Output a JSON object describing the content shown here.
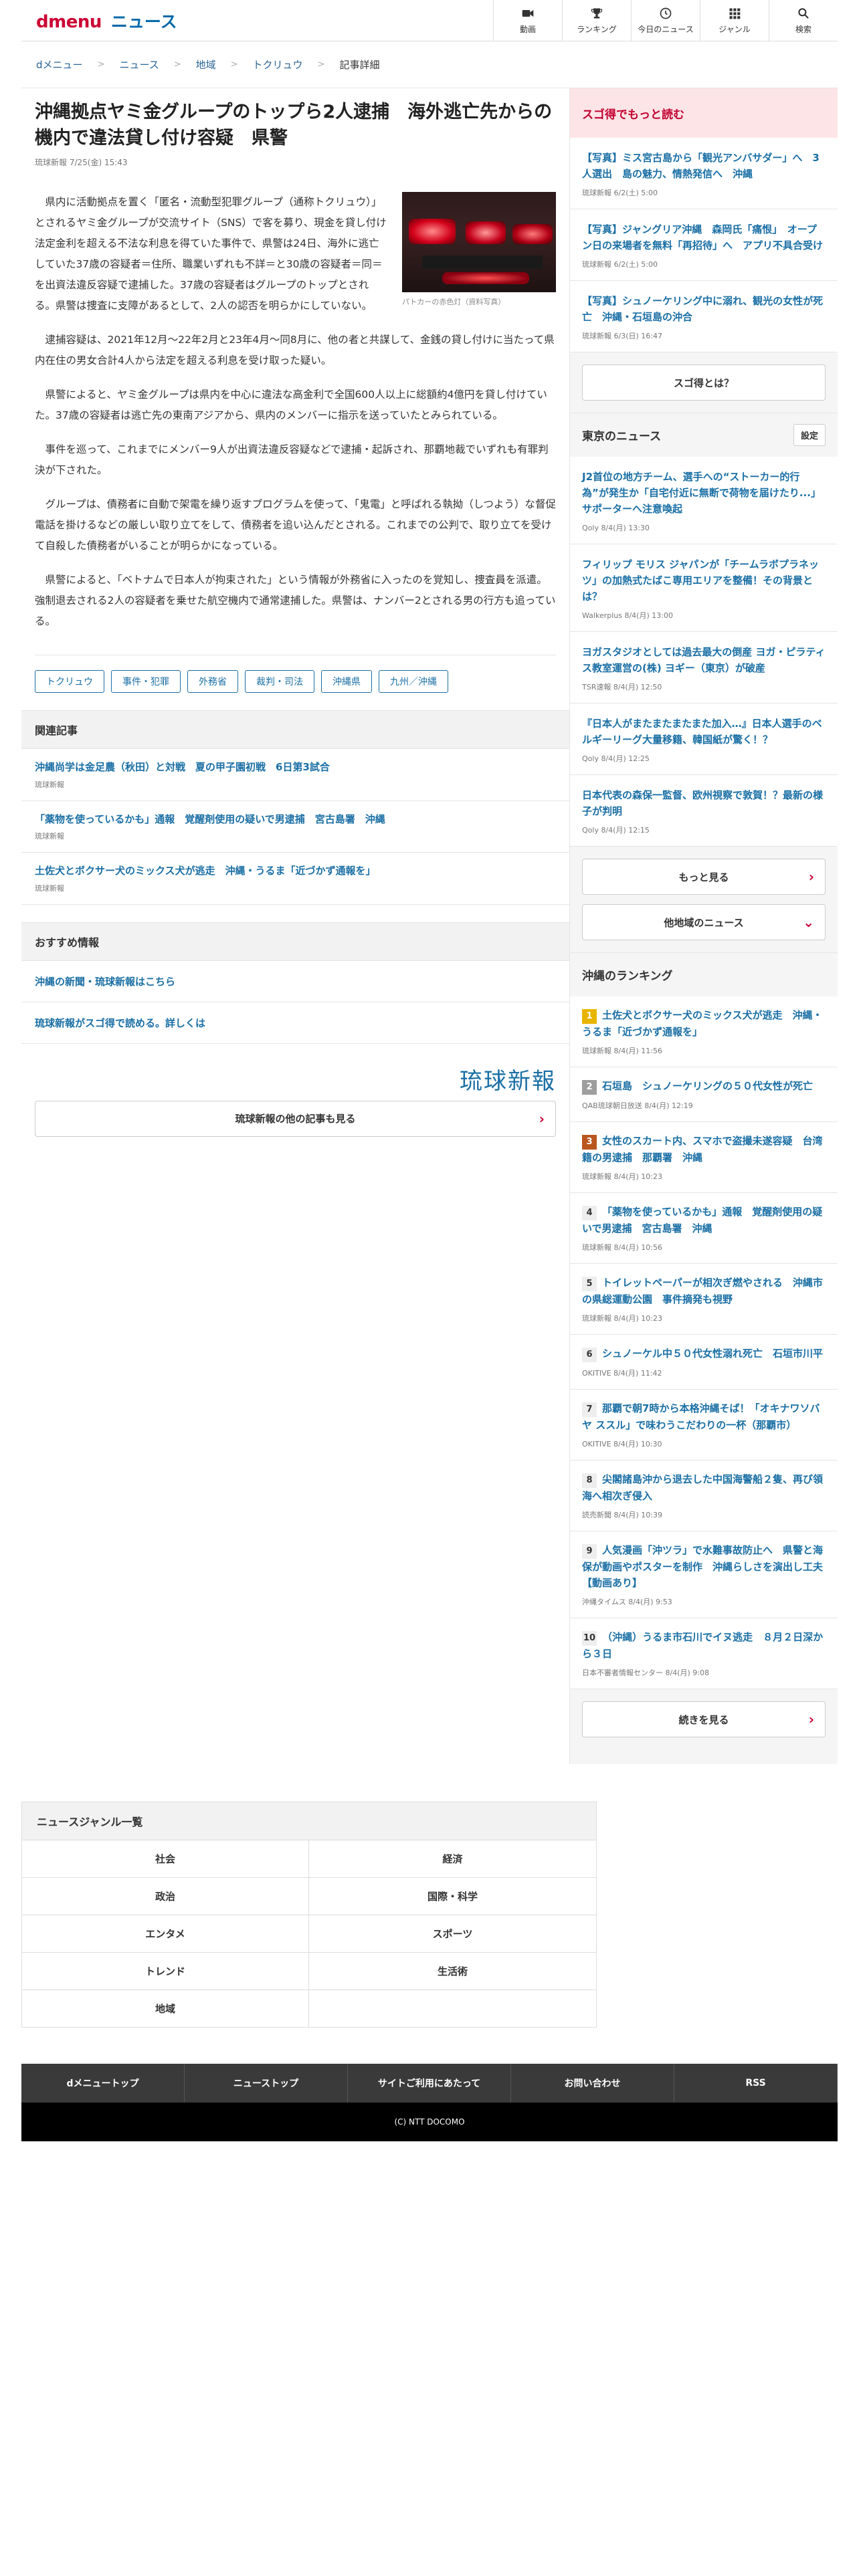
{
  "header": {
    "logo_d": "d",
    "logo_menu": "menu",
    "logo_news": "ニュース",
    "nav": [
      {
        "label": "動画",
        "icon": "video-icon"
      },
      {
        "label": "ランキング",
        "icon": "trophy-icon"
      },
      {
        "label": "今日のニュース",
        "icon": "clock-icon"
      },
      {
        "label": "ジャンル",
        "icon": "grid-icon"
      },
      {
        "label": "検索",
        "icon": "search-icon"
      }
    ]
  },
  "breadcrumb": [
    "dメニュー",
    "ニュース",
    "地域",
    "トクリュウ",
    "記事詳細"
  ],
  "article": {
    "title": "沖縄拠点ヤミ金グループのトップら2人逮捕　海外逃亡先からの機内で違法貸し付け容疑　県警",
    "meta": "琉球新報 7/25(金) 15:43",
    "photo_caption": "パトカーの赤色灯（資料写真）",
    "paragraphs": [
      "県内に活動拠点を置く「匿名・流動型犯罪グループ（通称トクリュウ）」とされるヤミ金グループが交流サイト（SNS）で客を募り、現金を貸し付け法定金利を超える不法な利息を得ていた事件で、県警は24日、海外に逃亡していた37歳の容疑者＝住所、職業いずれも不詳＝と30歳の容疑者＝同＝を出資法違反容疑で逮捕した。37歳の容疑者はグループのトップとされる。県警は捜査に支障があるとして、2人の認否を明らかにしていない。",
      "逮捕容疑は、2021年12月〜22年2月と23年4月〜同8月に、他の者と共謀して、金銭の貸し付けに当たって県内在住の男女合計4人から法定を超える利息を受け取った疑い。",
      "県警によると、ヤミ金グループは県内を中心に違法な高金利で全国600人以上に総額約4億円を貸し付けていた。37歳の容疑者は逃亡先の東南アジアから、県内のメンバーに指示を送っていたとみられている。",
      "事件を巡って、これまでにメンバー9人が出資法違反容疑などで逮捕・起訴され、那覇地裁でいずれも有罪判決が下された。",
      "グループは、債務者に自動で架電を繰り返すプログラムを使って、「鬼電」と呼ばれる執拗（しつよう）な督促電話を掛けるなどの厳しい取り立てをして、債務者を追い込んだとされる。これまでの公判で、取り立てを受けて自殺した債務者がいることが明らかになっている。",
      "県警によると、「ベトナムで日本人が拘束された」という情報が外務省に入ったのを覚知し、捜査員を派遣。強制退去される2人の容疑者を乗せた航空機内で通常逮捕した。県警は、ナンバー2とされる男の行方も追っている。"
    ],
    "tags": [
      "トクリュウ",
      "事件・犯罪",
      "外務省",
      "裁判・司法",
      "沖縄県",
      "九州／沖縄"
    ]
  },
  "related": {
    "heading": "関連記事",
    "items": [
      {
        "title": "沖縄尚学は金足農（秋田）と対戦　夏の甲子園初戦　6日第3試合",
        "source": "琉球新報"
      },
      {
        "title": "「薬物を使っているかも」通報　覚醒剤使用の疑いで男逮捕　宮古島署　沖縄",
        "source": "琉球新報"
      },
      {
        "title": "土佐犬とボクサー犬のミックス犬が逃走　沖縄・うるま「近づかず通報を」",
        "source": "琉球新報"
      }
    ]
  },
  "recommend": {
    "heading": "おすすめ情報",
    "items": [
      "沖縄の新聞・琉球新報はこちら",
      "琉球新報がスゴ得で読める。詳しくは"
    ]
  },
  "publisher": {
    "logo_text": "琉球新報",
    "more_label": "琉球新報の他の記事も見る"
  },
  "sugotoku": {
    "heading": "スゴ得でもっと読む",
    "items": [
      {
        "title": "【写真】ミス宮古島から「観光アンバサダー」へ　3人選出　島の魅力、情熱発信へ　沖縄",
        "meta": "琉球新報 6/2(土) 5:00"
      },
      {
        "title": "【写真】ジャングリア沖縄　森岡氏「痛恨」　オープン日の来場者を無料「再招待」へ　アプリ不具合受け",
        "meta": "琉球新報 6/2(土) 5:00"
      },
      {
        "title": "【写真】シュノーケリング中に溺れ、観光の女性が死亡　沖縄・石垣島の沖合",
        "meta": "琉球新報 6/3(日) 16:47"
      }
    ],
    "button": "スゴ得とは？"
  },
  "tokyo": {
    "heading": "東京のニュース",
    "setting": "設定",
    "items": [
      {
        "title": "J2首位の地方チーム、選手への“ストーカー的行為”が発生か「自宅付近に無断で荷物を届けたり...」サポーターへ注意喚起",
        "meta": "Qoly 8/4(月) 13:30"
      },
      {
        "title": "フィリップ モリス ジャパンが「チームラボプラネッツ」の加熱式たばこ専用エリアを整備！その背景とは？",
        "meta": "Walkerplus 8/4(月) 13:00"
      },
      {
        "title": "ヨガスタジオとしては過去最大の倒産 ヨガ・ピラティス教室運営の(株) ヨギー（東京）が破産",
        "meta": "TSR速報 8/4(月) 12:50"
      },
      {
        "title": "『日本人がまたまたまたまた加入…』日本人選手のベルギーリーグ大量移籍、韓国紙が驚く！？",
        "meta": "Qoly 8/4(月) 12:25"
      },
      {
        "title": "日本代表の森保一監督、欧州視察で敦賀！？最新の様子が判明",
        "meta": "Qoly 8/4(月) 12:15"
      }
    ],
    "more": "もっと見る",
    "other": "他地域のニュース"
  },
  "ranking": {
    "heading": "沖縄のランキング",
    "items": [
      {
        "rank": "1",
        "title": "土佐犬とボクサー犬のミックス犬が逃走　沖縄・うるま「近づかず通報を」",
        "meta": "琉球新報 8/4(月) 11:56"
      },
      {
        "rank": "2",
        "title": "石垣島　シュノーケリングの５０代女性が死亡",
        "meta": "QAB琉球朝日放送 8/4(月) 12:19"
      },
      {
        "rank": "3",
        "title": "女性のスカート内、スマホで盗撮未遂容疑　台湾籍の男逮捕　那覇署　沖縄",
        "meta": "琉球新報 8/4(月) 10:23"
      },
      {
        "rank": "4",
        "title": "「薬物を使っているかも」通報　覚醒剤使用の疑いで男逮捕　宮古島署　沖縄",
        "meta": "琉球新報 8/4(月) 10:56"
      },
      {
        "rank": "5",
        "title": "トイレットペーパーが相次ぎ燃やされる　沖縄市の県総運動公園　事件摘発も視野",
        "meta": "琉球新報 8/4(月) 10:23"
      },
      {
        "rank": "6",
        "title": "シュノーケル中５０代女性溺れ死亡　石垣市川平",
        "meta": "OKITIVE 8/4(月) 11:42"
      },
      {
        "rank": "7",
        "title": "那覇で朝7時から本格沖縄そば！「オキナワソバヤ ススル」で味わうこだわりの一杯（那覇市）",
        "meta": "OKITIVE 8/4(月) 10:30"
      },
      {
        "rank": "8",
        "title": "尖閣諸島沖から退去した中国海警船２隻、再び領海へ相次ぎ侵入",
        "meta": "読売新聞 8/4(月) 10:39"
      },
      {
        "rank": "9",
        "title": "人気漫画「沖ツラ」で水難事故防止へ　県警と海保が動画やポスターを制作　沖縄らしさを演出し工夫【動画あり】",
        "meta": "沖縄タイムス 8/4(月) 9:53"
      },
      {
        "rank": "10",
        "title": "（沖縄）うるま市石川でイヌ逃走　８月２日深から３日",
        "meta": "日本不審者情報センター 8/4(月) 9:08"
      }
    ],
    "more": "続きを見る"
  },
  "genre": {
    "heading": "ニュースジャンル一覧",
    "items": [
      "社会",
      "経済",
      "政治",
      "国際・科学",
      "エンタメ",
      "スポーツ",
      "トレンド",
      "生活術",
      "地域",
      ""
    ]
  },
  "footer": {
    "links": [
      "dメニュートップ",
      "ニューストップ",
      "サイトご利用にあたって",
      "お問い合わせ",
      "RSS"
    ],
    "copyright": "(C) NTT DOCOMO"
  },
  "colors": {
    "brand_red": "#cc0033",
    "link_blue": "#1a6fa5",
    "pink_bg": "#fde4e6"
  }
}
